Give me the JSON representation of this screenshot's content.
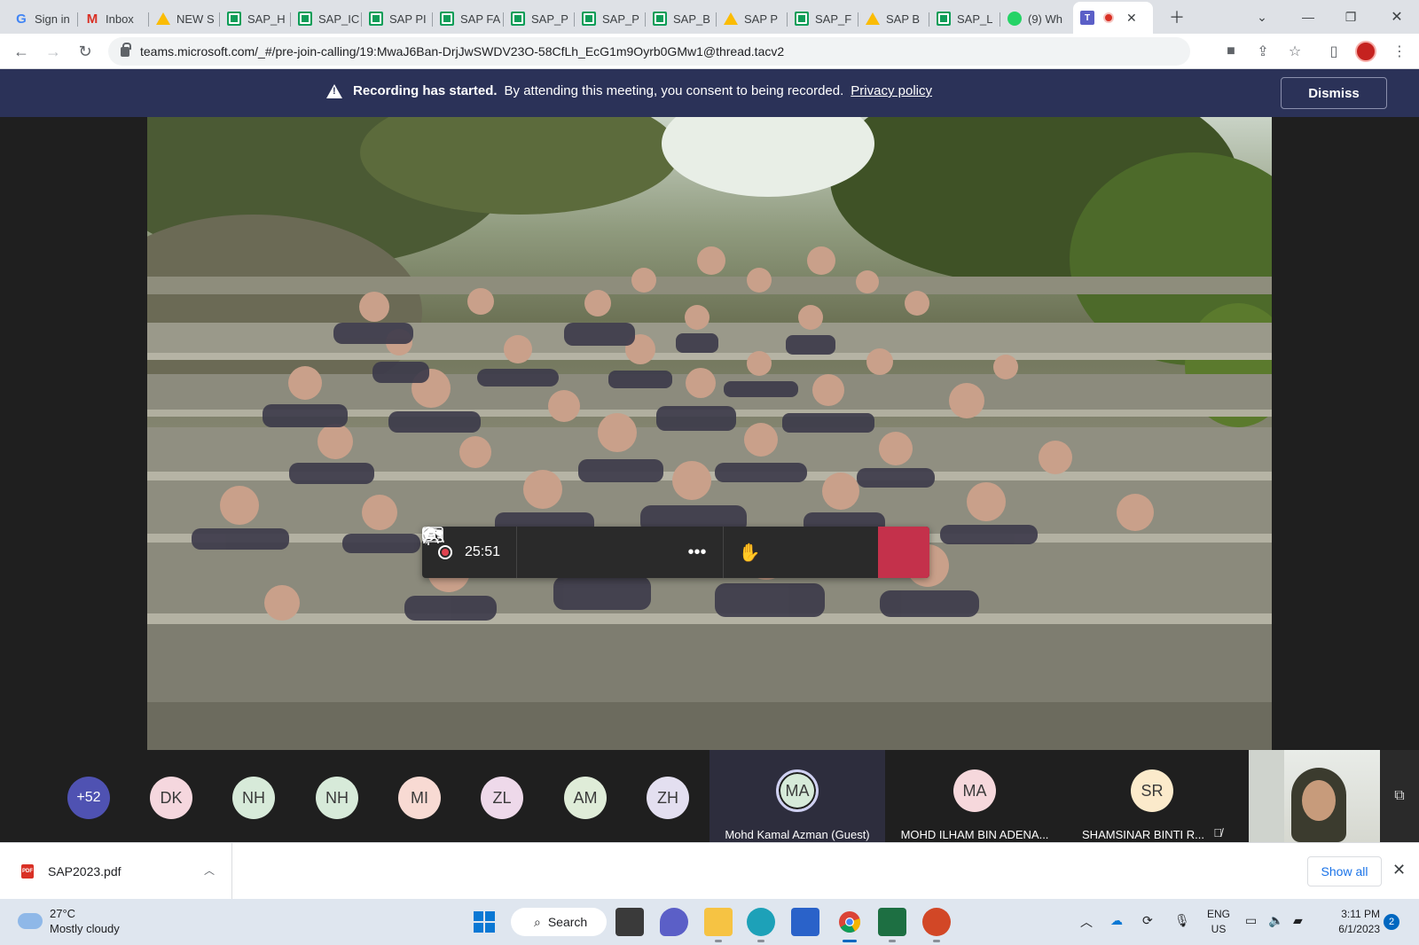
{
  "browser": {
    "tabs": [
      {
        "label": "Sign in",
        "icon": "google-icon"
      },
      {
        "label": "Inbox",
        "icon": "gmail-icon"
      },
      {
        "label": "NEW S",
        "icon": "google-drive-icon"
      },
      {
        "label": "SAP_H",
        "icon": "google-sheets-icon"
      },
      {
        "label": "SAP_IC",
        "icon": "google-sheets-icon"
      },
      {
        "label": "SAP PI",
        "icon": "google-sheets-icon"
      },
      {
        "label": "SAP FA",
        "icon": "google-sheets-icon"
      },
      {
        "label": "SAP_P",
        "icon": "google-sheets-icon"
      },
      {
        "label": "SAP_P",
        "icon": "google-sheets-icon"
      },
      {
        "label": "SAP_B",
        "icon": "google-sheets-icon"
      },
      {
        "label": "SAP P",
        "icon": "google-drive-icon"
      },
      {
        "label": "SAP_F",
        "icon": "google-sheets-icon"
      },
      {
        "label": "SAP B",
        "icon": "google-drive-icon"
      },
      {
        "label": "SAP_L",
        "icon": "google-sheets-icon"
      },
      {
        "label": "(9) Wh",
        "icon": "whatsapp-icon"
      }
    ],
    "url": "teams.microsoft.com/_#/pre-join-calling/19:MwaJ6Ban-DrjJwSWDV23O-58CfLh_EcG1m9Oyrb0GMw1@thread.tacv2"
  },
  "banner": {
    "bold": "Recording has started.",
    "text": "By attending this meeting, you consent to being recorded.",
    "link": "Privacy policy",
    "dismiss": "Dismiss"
  },
  "meeting": {
    "timer": "25:51"
  },
  "participants": {
    "overflow": "+52",
    "avatars": [
      {
        "initials": "DK",
        "color": "#f5d7de"
      },
      {
        "initials": "NH",
        "color": "#d7ead9"
      },
      {
        "initials": "NH",
        "color": "#d7ead9"
      },
      {
        "initials": "MI",
        "color": "#f8dad3"
      },
      {
        "initials": "ZL",
        "color": "#eed9ea"
      },
      {
        "initials": "AM",
        "color": "#dfecd8"
      },
      {
        "initials": "ZH",
        "color": "#e3dff0"
      }
    ],
    "tiles": [
      {
        "initials": "MA",
        "name": "Mohd Kamal Azman (Guest)",
        "color": "#d6ead9"
      },
      {
        "initials": "MA",
        "name": "MOHD ILHAM BIN ADENA...",
        "color": "#f6d8dc"
      },
      {
        "initials": "SR",
        "name": "SHAMSINAR BINTI R...",
        "color": "#fbeacb"
      }
    ]
  },
  "downloads": {
    "file": "SAP2023.pdf",
    "show_all": "Show all"
  },
  "taskbar": {
    "temperature": "27°C",
    "weather": "Mostly cloudy",
    "search": "Search",
    "lang1": "ENG",
    "lang2": "US",
    "time": "3:11 PM",
    "date": "6/1/2023",
    "notifications": "2"
  }
}
